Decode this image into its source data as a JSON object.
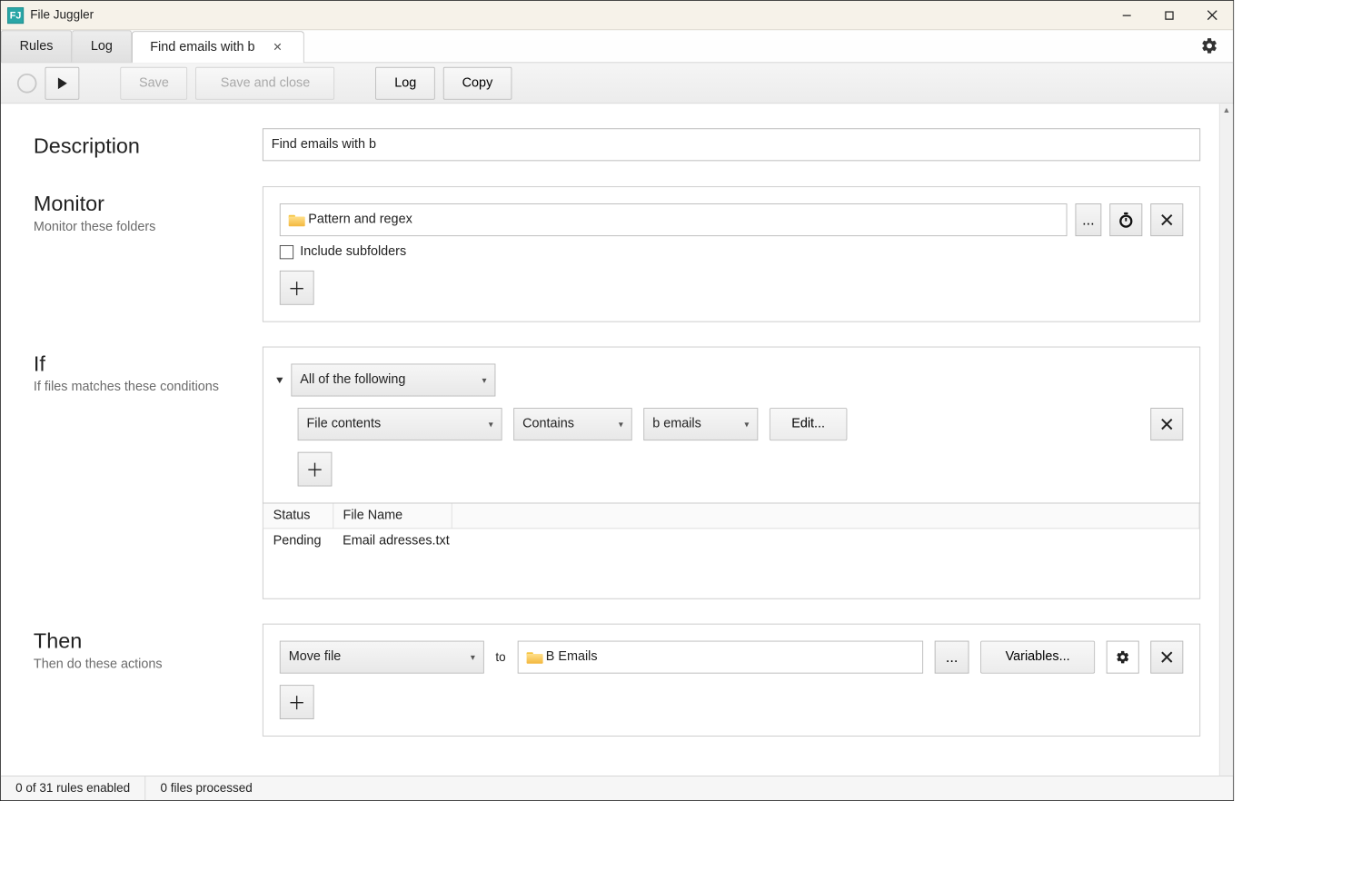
{
  "window": {
    "title": "File Juggler"
  },
  "tabs": {
    "items": [
      {
        "label": "Rules"
      },
      {
        "label": "Log"
      },
      {
        "label": "Find emails with b",
        "active": true
      }
    ]
  },
  "toolbar": {
    "save": "Save",
    "save_close": "Save and close",
    "log": "Log",
    "copy": "Copy"
  },
  "description": {
    "title": "Description",
    "value": "Find emails with b"
  },
  "monitor": {
    "title": "Monitor",
    "subtitle": "Monitor these folders",
    "folder": "Pattern and regex",
    "browse": "...",
    "include_subfolders_label": "Include subfolders",
    "include_subfolders_checked": false
  },
  "if": {
    "title": "If",
    "subtitle": "If files matches these conditions",
    "group_mode": "All of the following",
    "condition": {
      "field": "File contents",
      "operator": "Contains",
      "pattern": "b emails",
      "edit_label": "Edit..."
    },
    "table": {
      "headers": {
        "status": "Status",
        "filename": "File Name"
      },
      "rows": [
        {
          "status": "Pending",
          "filename": "Email adresses.txt"
        }
      ]
    }
  },
  "then": {
    "title": "Then",
    "subtitle": "Then do these actions",
    "action": "Move file",
    "to_label": "to",
    "destination": "B Emails",
    "browse": "...",
    "variables": "Variables..."
  },
  "statusbar": {
    "rules": "0 of 31 rules enabled",
    "processed": "0 files processed"
  }
}
